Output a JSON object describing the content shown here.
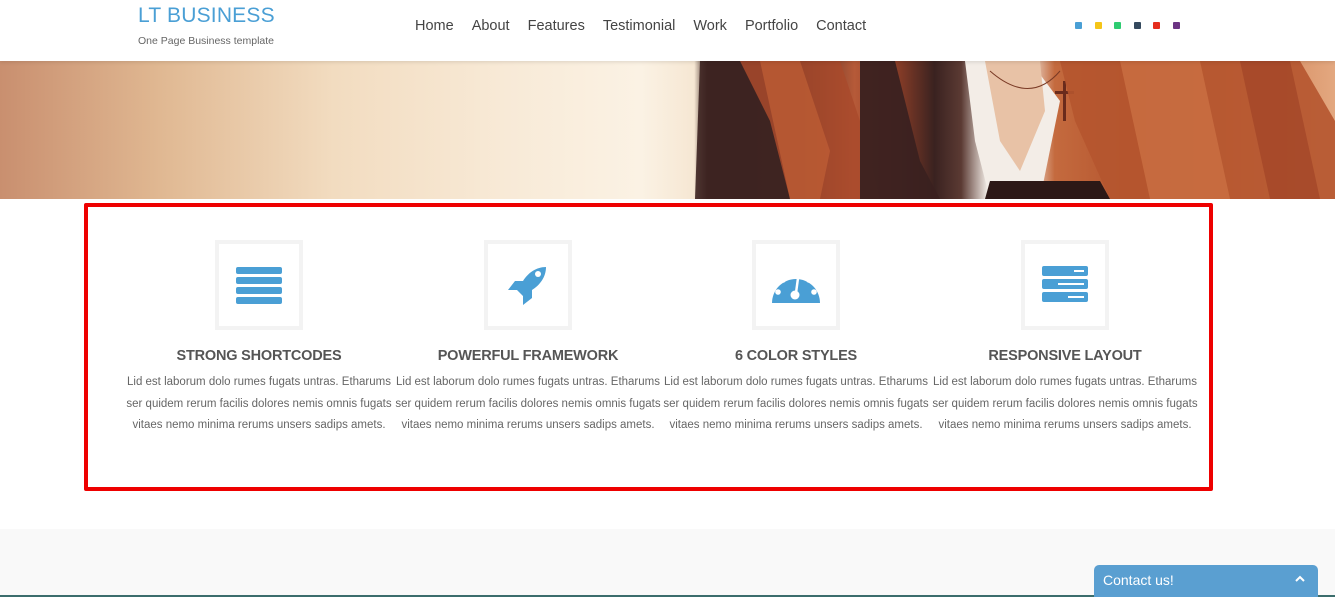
{
  "header": {
    "logo_title": "LT BUSINESS",
    "logo_subtitle": "One Page Business template",
    "nav": [
      {
        "label": "Home"
      },
      {
        "label": "About"
      },
      {
        "label": "Features"
      },
      {
        "label": "Testimonial"
      },
      {
        "label": "Work"
      },
      {
        "label": "Portfolio"
      },
      {
        "label": "Contact"
      }
    ],
    "color_swatches": [
      "#4a9fd5",
      "#f5c518",
      "#2ecc71",
      "#34495e",
      "#e52d1e",
      "#6c3483"
    ]
  },
  "hero": {
    "image": "woman-with-red-hair-in-dark-blazer"
  },
  "features": [
    {
      "icon": "list-icon",
      "title": "STRONG SHORTCODES",
      "text": "Lid est laborum dolo rumes fugats untras. Etharums ser quidem rerum facilis dolores nemis omnis fugats vitaes nemo minima rerums unsers sadips amets."
    },
    {
      "icon": "rocket-icon",
      "title": "POWERFUL FRAMEWORK",
      "text": "Lid est laborum dolo rumes fugats untras. Etharums ser quidem rerum facilis dolores nemis omnis fugats vitaes nemo minima rerums unsers sadips amets."
    },
    {
      "icon": "dashboard-gauge-icon",
      "title": "6 COLOR STYLES",
      "text": "Lid est laborum dolo rumes fugats untras. Etharums ser quidem rerum facilis dolores nemis omnis fugats vitaes nemo minima rerums unsers sadips amets."
    },
    {
      "icon": "server-icon",
      "title": "RESPONSIVE LAYOUT",
      "text": "Lid est laborum dolo rumes fugats untras. Etharums ser quidem rerum facilis dolores nemis omnis fugats vitaes nemo minima rerums unsers sadips amets."
    }
  ],
  "colors": {
    "accent": "#4a9fd5",
    "highlight_border": "#ee0000",
    "contact_tab": "#5a9fd1"
  },
  "contact_widget": {
    "label": "Contact us!",
    "icon": "chevron-up-icon"
  }
}
